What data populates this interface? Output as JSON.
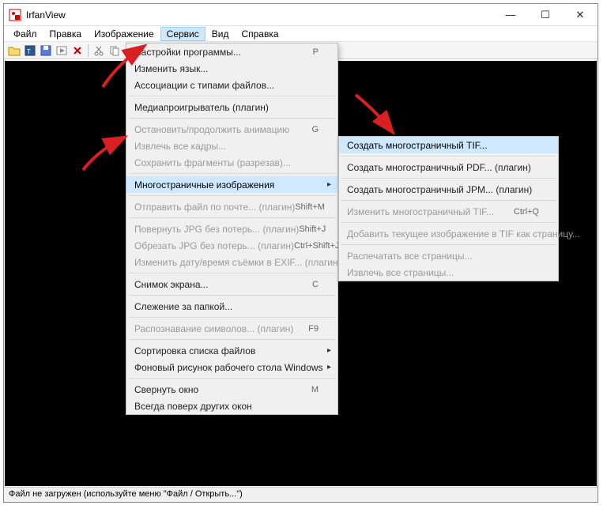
{
  "window": {
    "title": "IrfanView"
  },
  "winControls": {
    "min": "—",
    "max": "☐",
    "close": "✕"
  },
  "menubar": [
    "Файл",
    "Правка",
    "Изображение",
    "Сервис",
    "Вид",
    "Справка"
  ],
  "activeMenu": "Сервис",
  "statusbar": "Файл не загружен (используйте меню \"Файл / Открыть...\")",
  "dropdownMain": [
    {
      "label": "Настройки программы...",
      "shortcut": "P"
    },
    {
      "label": "Изменить язык..."
    },
    {
      "label": "Ассоциации с типами файлов..."
    },
    {
      "sep": true
    },
    {
      "label": "Медиапроигрыватель (плагин)"
    },
    {
      "sep": true
    },
    {
      "label": "Остановить/продолжить анимацию",
      "shortcut": "G",
      "disabled": true
    },
    {
      "label": "Извлечь все кадры...",
      "disabled": true
    },
    {
      "label": "Сохранить фрагменты (разрезав)...",
      "disabled": true
    },
    {
      "sep": true
    },
    {
      "label": "Многостраничные изображения",
      "submenu": true,
      "highlight": true
    },
    {
      "sep": true
    },
    {
      "label": "Отправить файл по почте... (плагин)",
      "shortcut": "Shift+M",
      "disabled": true
    },
    {
      "sep": true
    },
    {
      "label": "Повернуть JPG без потерь... (плагин)",
      "shortcut": "Shift+J",
      "disabled": true
    },
    {
      "label": "Обрезать JPG без потерь... (плагин)",
      "shortcut": "Ctrl+Shift+J",
      "disabled": true
    },
    {
      "label": "Изменить дату/время съёмки в EXIF... (плагин)",
      "disabled": true
    },
    {
      "sep": true
    },
    {
      "label": "Снимок экрана...",
      "shortcut": "C"
    },
    {
      "sep": true
    },
    {
      "label": "Слежение за папкой..."
    },
    {
      "sep": true
    },
    {
      "label": "Распознавание символов... (плагин)",
      "shortcut": "F9",
      "disabled": true
    },
    {
      "sep": true
    },
    {
      "label": "Сортировка списка файлов",
      "submenu": true
    },
    {
      "label": "Фоновый рисунок рабочего стола Windows",
      "submenu": true
    },
    {
      "sep": true
    },
    {
      "label": "Свернуть окно",
      "shortcut": "M"
    },
    {
      "label": "Всегда поверх других окон"
    }
  ],
  "dropdownSub": [
    {
      "label": "Создать многостраничный TIF...",
      "highlight": true
    },
    {
      "sep": true
    },
    {
      "label": "Создать многостраничный PDF... (плагин)"
    },
    {
      "sep": true
    },
    {
      "label": "Создать многостраничный JPM... (плагин)"
    },
    {
      "sep": true
    },
    {
      "label": "Изменить многостраничный TIF...",
      "shortcut": "Ctrl+Q",
      "disabled": true
    },
    {
      "sep": true
    },
    {
      "label": "Добавить текущее изображение в TIF как страницу...",
      "disabled": true
    },
    {
      "sep": true
    },
    {
      "label": "Распечатать все страницы...",
      "disabled": true
    },
    {
      "label": "Извлечь все страницы...",
      "disabled": true
    }
  ]
}
